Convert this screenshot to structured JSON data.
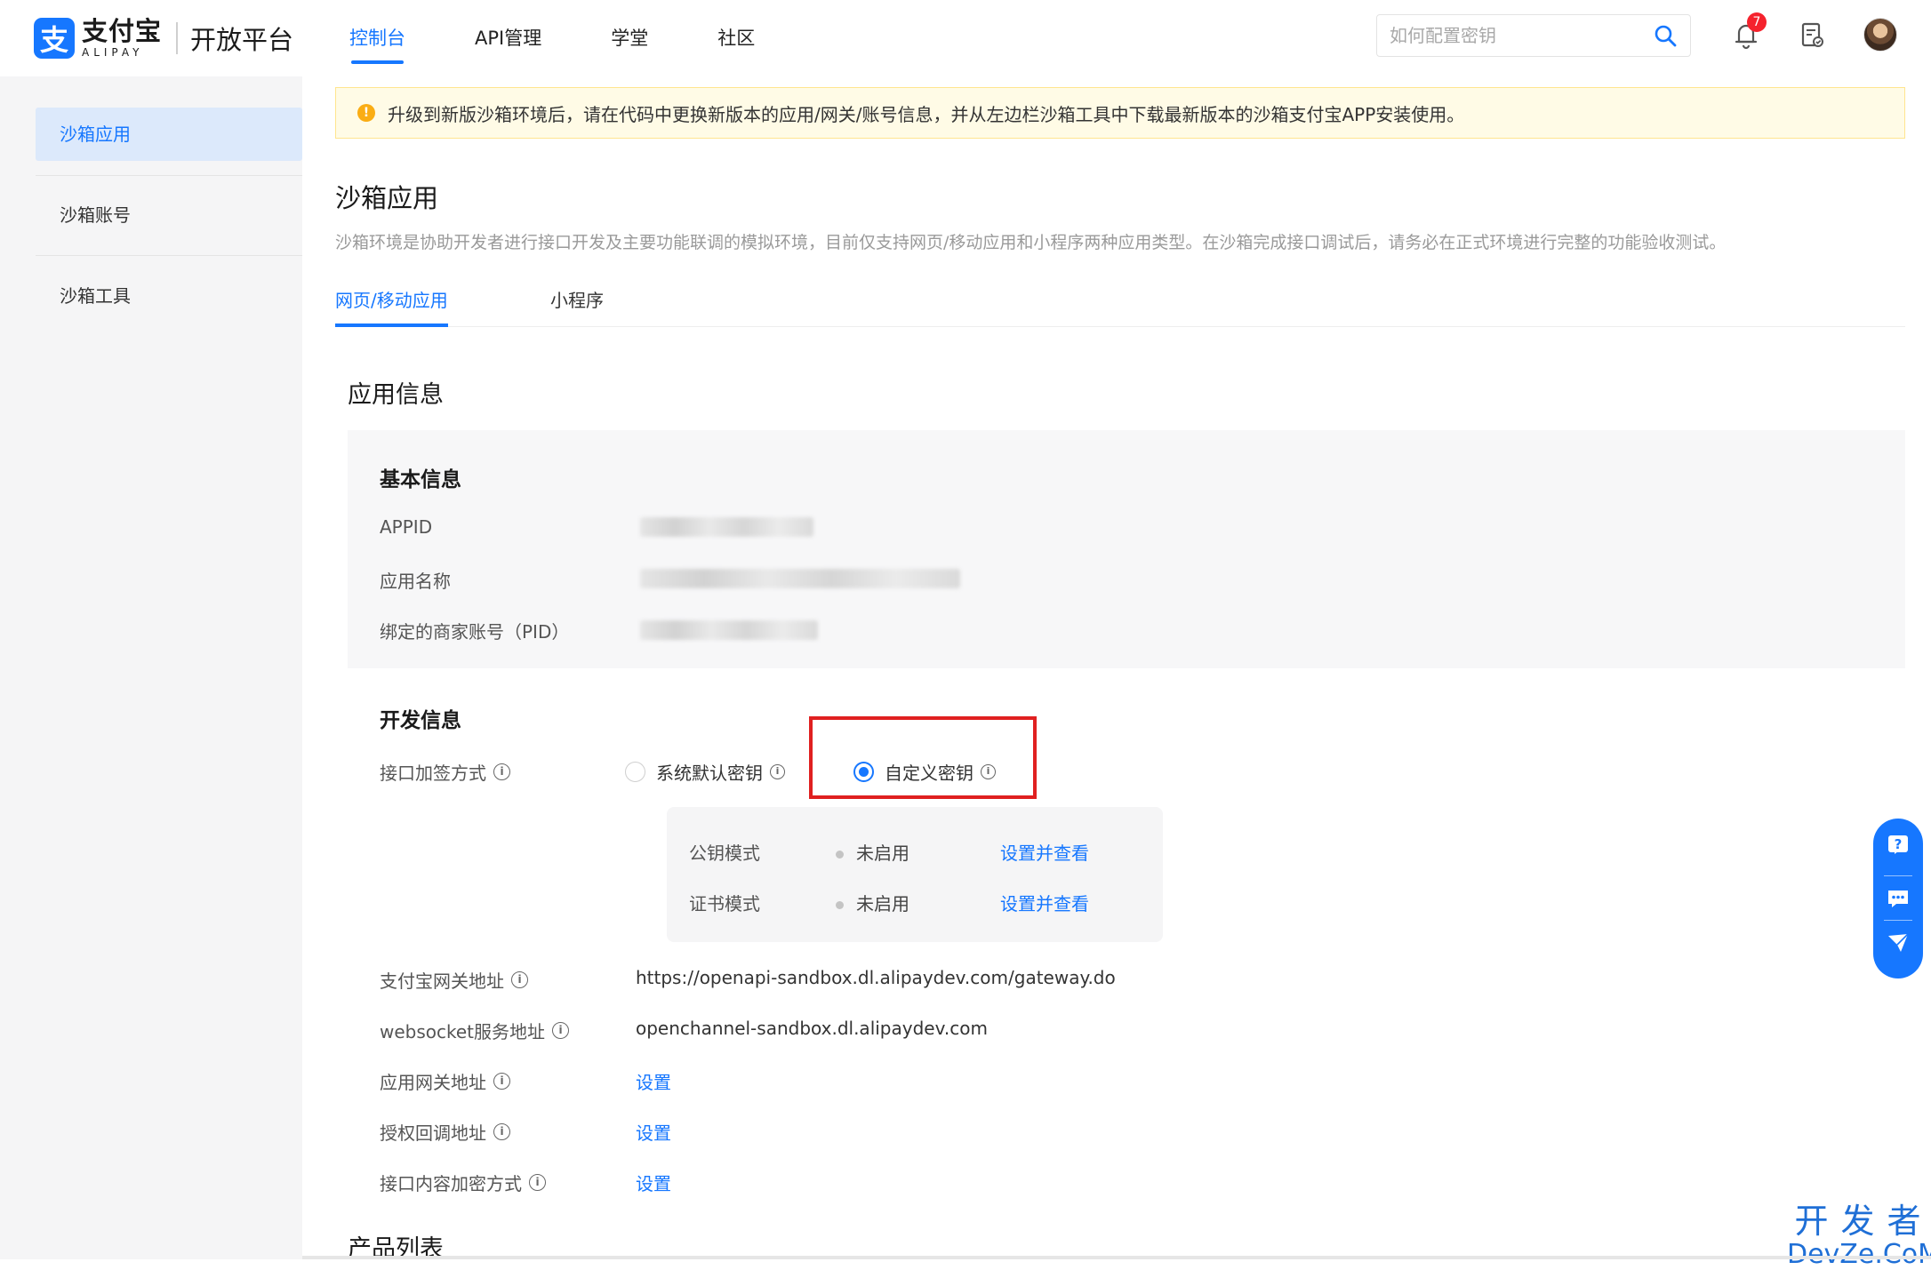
{
  "header": {
    "logo_mark": "支",
    "logo_cn": "支付宝",
    "logo_en": "ALIPAY",
    "platform": "开放平台",
    "nav": [
      {
        "label": "控制台",
        "active": true
      },
      {
        "label": "API管理",
        "active": false
      },
      {
        "label": "学堂",
        "active": false
      },
      {
        "label": "社区",
        "active": false
      }
    ],
    "search_placeholder": "如何配置密钥",
    "notification_count": "7"
  },
  "sidebar": {
    "items": [
      {
        "label": "沙箱应用",
        "active": true
      },
      {
        "label": "沙箱账号",
        "active": false
      },
      {
        "label": "沙箱工具",
        "active": false
      }
    ]
  },
  "notice": "升级到新版沙箱环境后，请在代码中更换新版本的应用/网关/账号信息，并从左边栏沙箱工具中下载最新版本的沙箱支付宝APP安装使用。",
  "page": {
    "title": "沙箱应用",
    "description": "沙箱环境是协助开发者进行接口开发及主要功能联调的模拟环境，目前仅支持网页/移动应用和小程序两种应用类型。在沙箱完成接口调试后，请务必在正式环境进行完整的功能验收测试。",
    "tabs": [
      {
        "label": "网页/移动应用",
        "active": true
      },
      {
        "label": "小程序",
        "active": false
      }
    ]
  },
  "app_info": {
    "title": "应用信息",
    "basic": {
      "title": "基本信息",
      "appid_label": "APPID",
      "name_label": "应用名称",
      "pid_label": "绑定的商家账号（PID）"
    },
    "dev": {
      "title": "开发信息",
      "sign_label": "接口加签方式",
      "sign_options": [
        {
          "label": "系统默认密钥",
          "checked": false
        },
        {
          "label": "自定义密钥",
          "checked": true
        }
      ],
      "key_modes": [
        {
          "label": "公钥模式",
          "status": "未启用",
          "action": "设置并查看"
        },
        {
          "label": "证书模式",
          "status": "未启用",
          "action": "设置并查看"
        }
      ],
      "gateway_label": "支付宝网关地址",
      "gateway_value": "https://openapi-sandbox.dl.alipaydev.com/gateway.do",
      "websocket_label": "websocket服务地址",
      "websocket_value": "openchannel-sandbox.dl.alipaydev.com",
      "app_gateway_label": "应用网关地址",
      "auth_callback_label": "授权回调地址",
      "encrypt_label": "接口内容加密方式",
      "set_label": "设置"
    }
  },
  "product_list_title": "产品列表",
  "watermark": {
    "cn": "开发者",
    "en": "DevZe.CoM"
  },
  "colors": {
    "accent": "#1677ff",
    "highlight": "#e02020",
    "notice_bg": "#fffbe6",
    "warn": "#faad14"
  }
}
